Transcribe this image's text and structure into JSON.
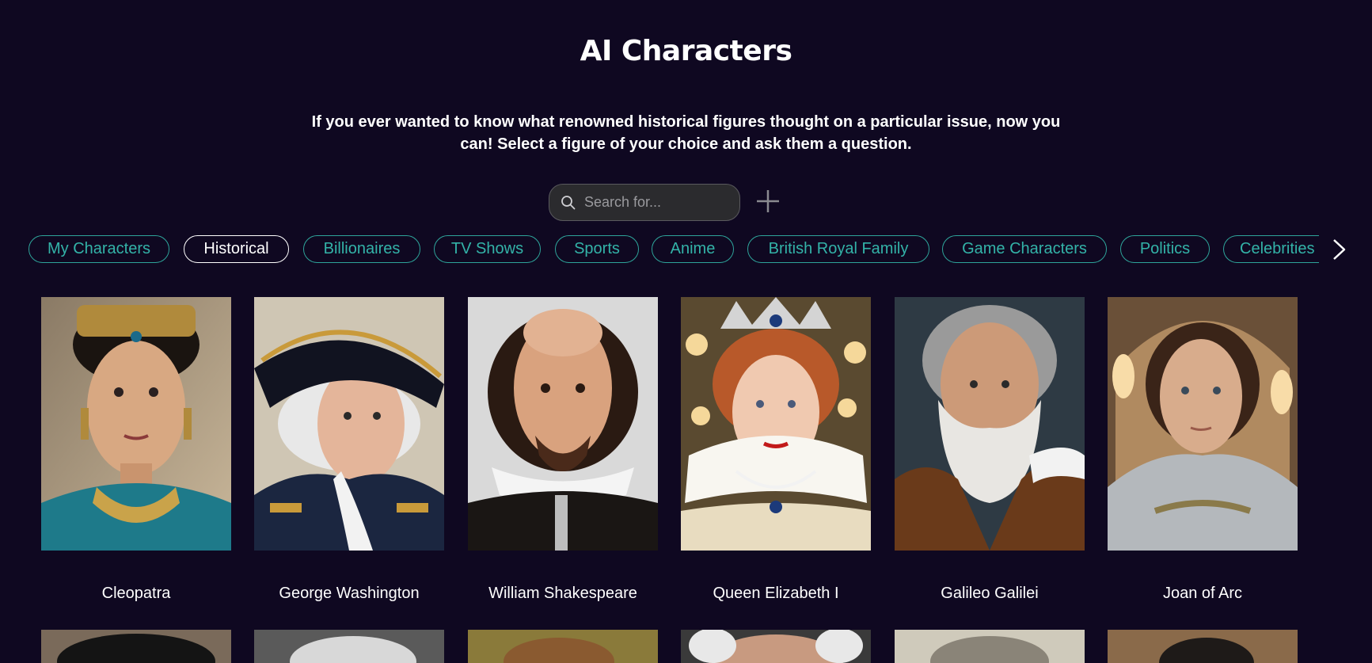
{
  "header": {
    "title": "AI Characters",
    "subtitle_line1": "If you ever wanted to know what renowned historical figures thought on a particular issue, now you",
    "subtitle_line2": "can! Select a figure of your choice and ask them a question."
  },
  "search": {
    "placeholder": "Search for...",
    "value": ""
  },
  "icons": {
    "search": "search-icon",
    "add": "plus-icon",
    "next": "chevron-right-icon"
  },
  "tabs": [
    {
      "label": "My Characters",
      "active": false
    },
    {
      "label": "Historical",
      "active": true
    },
    {
      "label": "Billionaires",
      "active": false
    },
    {
      "label": "TV Shows",
      "active": false
    },
    {
      "label": "Sports",
      "active": false
    },
    {
      "label": "Anime",
      "active": false
    },
    {
      "label": "British Royal Family",
      "active": false
    },
    {
      "label": "Game Characters",
      "active": false
    },
    {
      "label": "Politics",
      "active": false
    },
    {
      "label": "Celebrities",
      "active": false
    }
  ],
  "characters": [
    {
      "name": "Cleopatra"
    },
    {
      "name": "George Washington"
    },
    {
      "name": "William Shakespeare"
    },
    {
      "name": "Queen Elizabeth I"
    },
    {
      "name": "Galileo Galilei"
    },
    {
      "name": "Joan of Arc"
    }
  ],
  "colors": {
    "background": "#0f0821",
    "accent": "#33b3a8",
    "search_bg": "#2b2b2e"
  }
}
